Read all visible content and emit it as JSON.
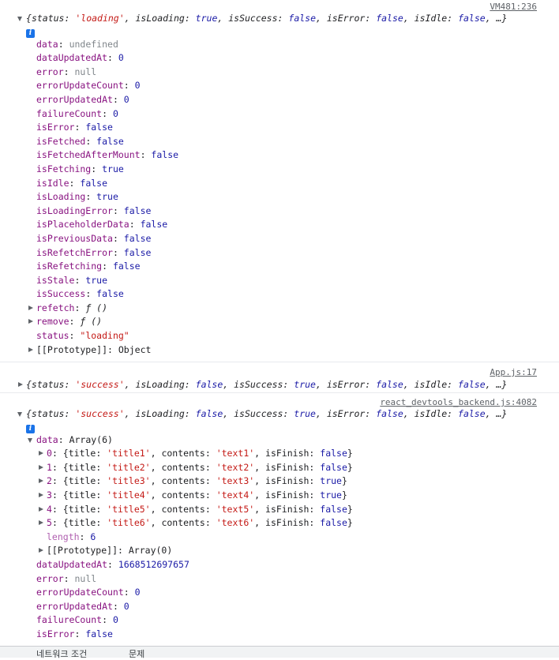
{
  "messages": [
    {
      "source": "VM481:236",
      "summary": [
        {
          "t": "{",
          "c": "plain"
        },
        {
          "t": "status",
          "c": "plain"
        },
        {
          "t": ": ",
          "c": "plain"
        },
        {
          "t": "'loading'",
          "c": "str"
        },
        {
          "t": ", isLoading: ",
          "c": "plain"
        },
        {
          "t": "true",
          "c": "bool"
        },
        {
          "t": ", isSuccess: ",
          "c": "plain"
        },
        {
          "t": "false",
          "c": "bool"
        },
        {
          "t": ", isError: ",
          "c": "plain"
        },
        {
          "t": "false",
          "c": "bool"
        },
        {
          "t": ", isIdle: ",
          "c": "plain"
        },
        {
          "t": "false",
          "c": "bool"
        },
        {
          "t": ", …}",
          "c": "plain"
        }
      ],
      "props": [
        {
          "k": "data",
          "v": "undefined",
          "vt": "und"
        },
        {
          "k": "dataUpdatedAt",
          "v": "0",
          "vt": "num"
        },
        {
          "k": "error",
          "v": "null",
          "vt": "und"
        },
        {
          "k": "errorUpdateCount",
          "v": "0",
          "vt": "num"
        },
        {
          "k": "errorUpdatedAt",
          "v": "0",
          "vt": "num"
        },
        {
          "k": "failureCount",
          "v": "0",
          "vt": "num"
        },
        {
          "k": "isError",
          "v": "false",
          "vt": "bool"
        },
        {
          "k": "isFetched",
          "v": "false",
          "vt": "bool"
        },
        {
          "k": "isFetchedAfterMount",
          "v": "false",
          "vt": "bool"
        },
        {
          "k": "isFetching",
          "v": "true",
          "vt": "bool"
        },
        {
          "k": "isIdle",
          "v": "false",
          "vt": "bool"
        },
        {
          "k": "isLoading",
          "v": "true",
          "vt": "bool"
        },
        {
          "k": "isLoadingError",
          "v": "false",
          "vt": "bool"
        },
        {
          "k": "isPlaceholderData",
          "v": "false",
          "vt": "bool"
        },
        {
          "k": "isPreviousData",
          "v": "false",
          "vt": "bool"
        },
        {
          "k": "isRefetchError",
          "v": "false",
          "vt": "bool"
        },
        {
          "k": "isRefetching",
          "v": "false",
          "vt": "bool"
        },
        {
          "k": "isStale",
          "v": "true",
          "vt": "bool"
        },
        {
          "k": "isSuccess",
          "v": "false",
          "vt": "bool"
        },
        {
          "k": "refetch",
          "v": "ƒ ()",
          "vt": "fn",
          "expand": true
        },
        {
          "k": "remove",
          "v": "ƒ ()",
          "vt": "fn",
          "expand": true
        },
        {
          "k": "status",
          "v": "\"loading\"",
          "vt": "str"
        },
        {
          "k": "[[Prototype]]",
          "v": "Object",
          "vt": "plain",
          "expand": true,
          "kc": "plain"
        }
      ]
    },
    {
      "source": "App.js:17",
      "summary": [
        {
          "t": "{status: ",
          "c": "plain"
        },
        {
          "t": "'success'",
          "c": "str"
        },
        {
          "t": ", isLoading: ",
          "c": "plain"
        },
        {
          "t": "false",
          "c": "bool"
        },
        {
          "t": ", isSuccess: ",
          "c": "plain"
        },
        {
          "t": "true",
          "c": "bool"
        },
        {
          "t": ", isError: ",
          "c": "plain"
        },
        {
          "t": "false",
          "c": "bool"
        },
        {
          "t": ", isIdle: ",
          "c": "plain"
        },
        {
          "t": "false",
          "c": "bool"
        },
        {
          "t": ", …}",
          "c": "plain"
        }
      ]
    },
    {
      "source": "react_devtools_backend.js:4082",
      "summary": [
        {
          "t": "{status: ",
          "c": "plain"
        },
        {
          "t": "'success'",
          "c": "str"
        },
        {
          "t": ", isLoading: ",
          "c": "plain"
        },
        {
          "t": "false",
          "c": "bool"
        },
        {
          "t": ", isSuccess: ",
          "c": "plain"
        },
        {
          "t": "true",
          "c": "bool"
        },
        {
          "t": ", isError: ",
          "c": "plain"
        },
        {
          "t": "false",
          "c": "bool"
        },
        {
          "t": ", isIdle: ",
          "c": "plain"
        },
        {
          "t": "false",
          "c": "bool"
        },
        {
          "t": ", …}",
          "c": "plain"
        }
      ],
      "data_label": "Array(6)",
      "items": [
        {
          "i": "0",
          "title": "'title1'",
          "contents": "'text1'",
          "isFinish": "false"
        },
        {
          "i": "1",
          "title": "'title2'",
          "contents": "'text2'",
          "isFinish": "false"
        },
        {
          "i": "2",
          "title": "'title3'",
          "contents": "'text3'",
          "isFinish": "true"
        },
        {
          "i": "3",
          "title": "'title4'",
          "contents": "'text4'",
          "isFinish": "true"
        },
        {
          "i": "4",
          "title": "'title5'",
          "contents": "'text5'",
          "isFinish": "false"
        },
        {
          "i": "5",
          "title": "'title6'",
          "contents": "'text6'",
          "isFinish": "false"
        }
      ],
      "length_key": "length",
      "length_val": "6",
      "proto_key": "[[Prototype]]",
      "proto_val": "Array(0)",
      "props": [
        {
          "k": "dataUpdatedAt",
          "v": "1668512697657",
          "vt": "num"
        },
        {
          "k": "error",
          "v": "null",
          "vt": "und"
        },
        {
          "k": "errorUpdateCount",
          "v": "0",
          "vt": "num"
        },
        {
          "k": "errorUpdatedAt",
          "v": "0",
          "vt": "num"
        },
        {
          "k": "failureCount",
          "v": "0",
          "vt": "num"
        },
        {
          "k": "isError",
          "v": "false",
          "vt": "bool"
        }
      ]
    }
  ],
  "labels": {
    "data_key": "data",
    "title_key": "title",
    "contents_key": "contents",
    "isFinish_key": "isFinish",
    "info_glyph": "i"
  },
  "bottom_tabs": [
    "네트워크 조건",
    "문제"
  ]
}
